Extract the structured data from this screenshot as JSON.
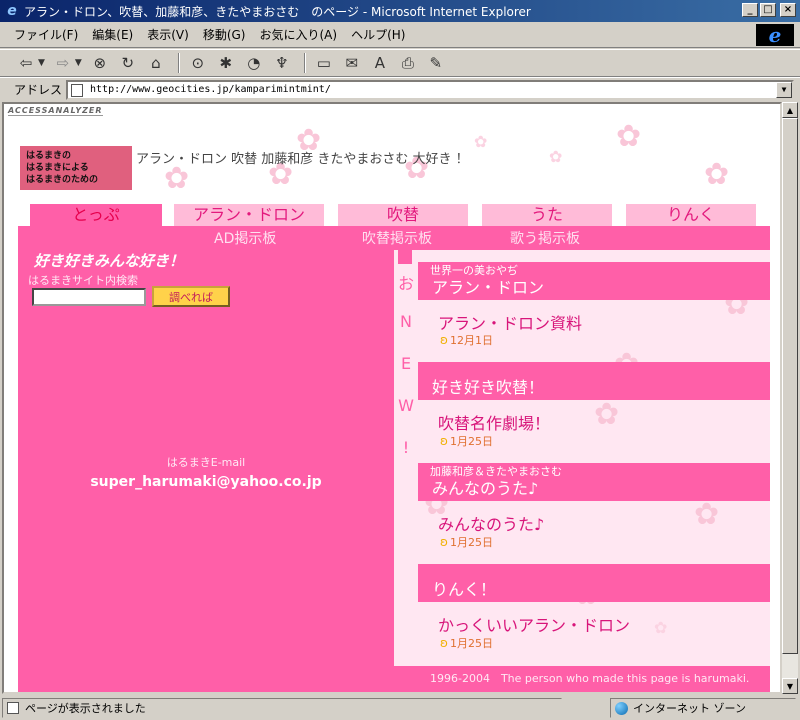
{
  "window": {
    "title": "アラン・ドロン、吹替、加藤和彦、きたやまおさむ　のページ - Microsoft Internet Explorer",
    "buttons": [
      "_",
      "□",
      "×"
    ]
  },
  "menu": [
    "ファイル(F)",
    "編集(E)",
    "表示(V)",
    "移動(G)",
    "お気に入り(A)",
    "ヘルプ(H)"
  ],
  "address": {
    "label": "アドレス",
    "url": "http://www.geocities.jp/kamparimintmint/"
  },
  "page": {
    "access_analyzer": "ACCESSANALYZER",
    "logo_lines": [
      "はるまきの",
      "はるまきによる",
      "はるまきのための"
    ],
    "slogan": "アラン・ドロン 吹替 加藤和彦 きたやまおさむ 大好き ！",
    "tabs": [
      "とっぷ",
      "アラン・ドロン",
      "吹替",
      "うた",
      "りんく"
    ],
    "subnav": [
      "AD掲示板",
      "吹替掲示板",
      "歌う掲示板"
    ],
    "search": {
      "title": "好き好きみんな好き！",
      "subtitle": "はるまきサイト内検索",
      "input_value": "",
      "button": "調べれば"
    },
    "email": {
      "label": "はるまきE-mail",
      "address": "super_harumaki@yahoo.co.jp"
    },
    "news_vertical": [
      "お",
      "N",
      "E",
      "W",
      "!"
    ],
    "sections": [
      {
        "small": "世界一の美おやぢ",
        "title": "アラン・ドロン",
        "link": "アラン・ドロン資料",
        "date": "12月1日"
      },
      {
        "small": "",
        "title": "好き好き吹替！",
        "link": "吹替名作劇場！",
        "date": "1月25日"
      },
      {
        "small": "加藤和彦＆きたやまおさむ",
        "title": "みんなのうた♪",
        "link": "みんなのうた♪",
        "date": "1月25日"
      },
      {
        "small": "",
        "title": "りんく！",
        "link": "かっくいいアラン・ドロン",
        "date": "1月25日"
      }
    ],
    "footer": "1996-2004　The person who made this page is harumaki."
  },
  "status": {
    "text": "ページが表示されました",
    "zone": "インターネット ゾーン"
  }
}
